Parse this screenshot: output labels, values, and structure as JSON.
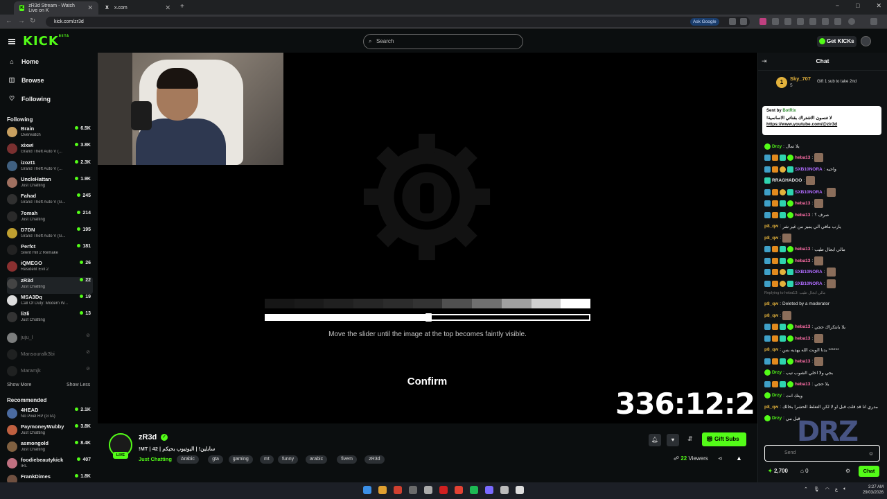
{
  "browser": {
    "tabs": [
      {
        "title": "zR3d Stream - Watch Live on K",
        "active": true
      },
      {
        "title": "x.com",
        "active": false
      }
    ],
    "url": "kick.com/zr3d",
    "ask_google": "Ask Google",
    "window_controls": [
      "−",
      "□",
      "✕"
    ]
  },
  "header": {
    "logo": "KICK",
    "logo_super": "BETA",
    "search_placeholder": "Search",
    "get_kicks": "Get KICKs"
  },
  "sidebar": {
    "nav": [
      {
        "label": "Home",
        "icon": "home-icon"
      },
      {
        "label": "Browse",
        "icon": "browse-icon"
      },
      {
        "label": "Following",
        "icon": "heart-icon"
      }
    ],
    "following_heading": "Following",
    "following": [
      {
        "name": "Brain",
        "game": "Overwatch",
        "viewers": "6.5K",
        "color": "#c8a060"
      },
      {
        "name": "xixwi",
        "game": "Grand Theft Auto V (...",
        "viewers": "3.8K",
        "color": "#7a3030"
      },
      {
        "name": "izozt1",
        "game": "Grand Theft Auto V (...",
        "viewers": "2.3K",
        "color": "#406080"
      },
      {
        "name": "UncleHattan",
        "game": "Just Chatting",
        "viewers": "1.9K",
        "color": "#a07060"
      },
      {
        "name": "Fahad",
        "game": "Grand Theft Auto V (G...",
        "viewers": "245",
        "color": "#303030"
      },
      {
        "name": "7omah",
        "game": "Just Chatting",
        "viewers": "214",
        "color": "#2a2a2a"
      },
      {
        "name": "D7DN",
        "game": "Grand Theft Auto V (G...",
        "viewers": "195",
        "color": "#c0a030"
      },
      {
        "name": "Perfct",
        "game": "Silent Hill 2 Remake",
        "viewers": "181",
        "color": "#222"
      },
      {
        "name": "iQMEGO",
        "game": "Resident Evil 2",
        "viewers": "26",
        "color": "#8a3030"
      },
      {
        "name": "zR3d",
        "game": "Just Chatting",
        "viewers": "22",
        "color": "#444"
      },
      {
        "name": "MSA3Dq",
        "game": "Call Of Duty: Modern W...",
        "viewers": "19",
        "color": "#ddd"
      },
      {
        "name": "li3li",
        "game": "Just Chatting",
        "viewers": "13",
        "color": "#333"
      }
    ],
    "offline": [
      {
        "name": "juju_l",
        "color": "#eee"
      },
      {
        "name": "Mansouralk3bi",
        "color": "#333"
      },
      {
        "name": "Maramjk",
        "color": "#333"
      }
    ],
    "show_more": "Show More",
    "show_less": "Show Less",
    "recommended_heading": "Recommended",
    "recommended": [
      {
        "name": "4HEAD",
        "game": "No Pixel RP (GTA)",
        "viewers": "2.1K",
        "color": "#4a6aa0"
      },
      {
        "name": "PaymoneyWubby",
        "game": "Just Chatting",
        "viewers": "3.8K",
        "color": "#c06040"
      },
      {
        "name": "asmongold",
        "game": "Just Chatting",
        "viewers": "8.4K",
        "color": "#806040"
      },
      {
        "name": "foodiebeautykick",
        "game": "IRL",
        "viewers": "407",
        "color": "#c07080"
      },
      {
        "name": "FrankDimes",
        "game": "",
        "viewers": "1.8K",
        "color": "#705040"
      }
    ]
  },
  "player": {
    "slider_instruction": "Move the slider until the image at the top becomes faintly visible.",
    "slider_value_percent": 50,
    "confirm_label": "Confirm",
    "timer": "336:12:21",
    "strip_colors": [
      "#161616",
      "#1a1a1a",
      "#202020",
      "#262626",
      "#2c2c2c",
      "#333333",
      "#505050",
      "#707070",
      "#a0a0a0",
      "#d0d0d0",
      "#ffffff"
    ]
  },
  "stream": {
    "name": "zR3d",
    "live": "LIVE",
    "title": "!MT | 42 | سابلين! | اليوتيوب بحيكم",
    "category": "Just Chatting",
    "tags": [
      "Arabic",
      "gta",
      "gaming",
      "mt",
      "funny",
      "arabic",
      "fivem",
      "zR3d"
    ],
    "viewers": "22",
    "viewers_label": "Viewers",
    "gift_subs": "Gift Subs"
  },
  "chat": {
    "title": "Chat",
    "gifter": {
      "rank": "1",
      "name": "Sky_707",
      "count": "5",
      "gift_text": "Gift 1 sub to take 2nd"
    },
    "pinned": {
      "sent_by_label": "Sent by",
      "sent_by": "BotRix",
      "text": "!لا تنسون الاشتراك بقناتي الاساسية",
      "link": "https://www.youtube.com/@zir3d"
    },
    "messages": [
      {
        "user": "Drzy",
        "color": "#53fc18",
        "text": "يلا تمال",
        "badges": [
          "D"
        ],
        "emote": false
      },
      {
        "user": "heba13",
        "color": "#ff6fa8",
        "text": "",
        "badges": [
          "A",
          "B",
          "C",
          "D"
        ],
        "emote": true
      },
      {
        "user": "SXB10NORA",
        "color": "#b06cff",
        "text": "واحيه",
        "badges": [
          "A",
          "B",
          "E",
          "C"
        ],
        "emote": false
      },
      {
        "user": "RRAGHADOO",
        "color": "#e8e8e8",
        "text": "",
        "badges": [
          "C"
        ],
        "emote": true
      },
      {
        "user": "SXB10NORA",
        "color": "#b06cff",
        "text": "",
        "badges": [
          "A",
          "B",
          "E",
          "C"
        ],
        "emote": true
      },
      {
        "user": "heba13",
        "color": "#ff6fa8",
        "text": "",
        "badges": [
          "A",
          "B",
          "C",
          "D"
        ],
        "emote": true
      },
      {
        "user": "heba13",
        "color": "#ff6fa8",
        "text": "صرف ؟",
        "badges": [
          "A",
          "B",
          "C",
          "D"
        ],
        "emote": false
      },
      {
        "user": "p8_qw",
        "color": "#e3b23c",
        "text": "يارب مافي الي يميز من غير شر",
        "badges": [],
        "emote": false
      },
      {
        "user": "p8_qw",
        "color": "#e3b23c",
        "text": "",
        "badges": [],
        "emote": true
      },
      {
        "user": "heba13",
        "color": "#ff6fa8",
        "text": "مالي ابجال طيب",
        "badges": [
          "A",
          "B",
          "C",
          "D"
        ],
        "emote": false
      },
      {
        "user": "heba13",
        "color": "#ff6fa8",
        "text": "",
        "badges": [
          "A",
          "B",
          "C",
          "D"
        ],
        "emote": true
      },
      {
        "user": "SXB10NORA",
        "color": "#b06cff",
        "text": "",
        "badges": [
          "A",
          "B",
          "E",
          "C"
        ],
        "emote": true
      },
      {
        "user": "SXB10NORA",
        "color": "#b06cff",
        "text": "",
        "badges": [
          "A",
          "B",
          "E",
          "C"
        ],
        "emote": true
      },
      {
        "user": "p8_qw",
        "color": "#e3b23c",
        "text": "Deleted by a moderator",
        "badges": [],
        "emote": false
      },
      {
        "user": "p8_qw",
        "color": "#e3b23c",
        "text": "",
        "badges": [],
        "emote": true
      },
      {
        "user": "heba13",
        "color": "#ff6fa8",
        "text": "يلا بانتكراك حجي",
        "badges": [
          "A",
          "B",
          "C",
          "D"
        ],
        "emote": false
      },
      {
        "user": "heba13",
        "color": "#ff6fa8",
        "text": "",
        "badges": [
          "A",
          "B",
          "C",
          "D"
        ],
        "emote": true
      },
      {
        "user": "p8_qw",
        "color": "#e3b23c",
        "text": "بدنا الوبت الله يهديه بس ******",
        "badges": [],
        "emote": false
      },
      {
        "user": "heba13",
        "color": "#ff6fa8",
        "text": "",
        "badges": [
          "A",
          "B",
          "C",
          "D"
        ],
        "emote": true
      },
      {
        "user": "Drzy",
        "color": "#53fc18",
        "text": "بجي ولا اخلي الشوب تيب",
        "badges": [
          "D"
        ],
        "emote": false
      },
      {
        "user": "heba13",
        "color": "#ff6fa8",
        "text": "يلا حجي",
        "badges": [
          "A",
          "B",
          "C",
          "D"
        ],
        "emote": false
      },
      {
        "user": "Drzy",
        "color": "#53fc18",
        "text": "ويتك انت",
        "badges": [
          "D"
        ],
        "emote": false
      },
      {
        "user": "p8_qw",
        "color": "#e3b23c",
        "text": "مدري انا قد قلت قبل او لا لكن التغلط الحشرا بخالك",
        "badges": [],
        "emote": false
      },
      {
        "user": "Drzy",
        "color": "#53fc18",
        "text": "قبل مي",
        "badges": [
          "D"
        ],
        "emote": false
      }
    ],
    "replying_to": "Replying to heba13: مالي ابجال طيب",
    "input_placeholder": "Send",
    "points": "2,700",
    "crowns": "0",
    "chat_button": "Chat",
    "watermark": "DRZ"
  },
  "taskbar": {
    "time": "3:27 AM",
    "date": "29/03/2026",
    "app_colors": [
      "#3b8fe6",
      "#e0a030",
      "#d04030",
      "#6b6b6b",
      "#aaaaaa",
      "#d02020",
      "#e34234",
      "#1db954",
      "#7a6aff",
      "#bbbbbb",
      "#dddddd"
    ]
  }
}
